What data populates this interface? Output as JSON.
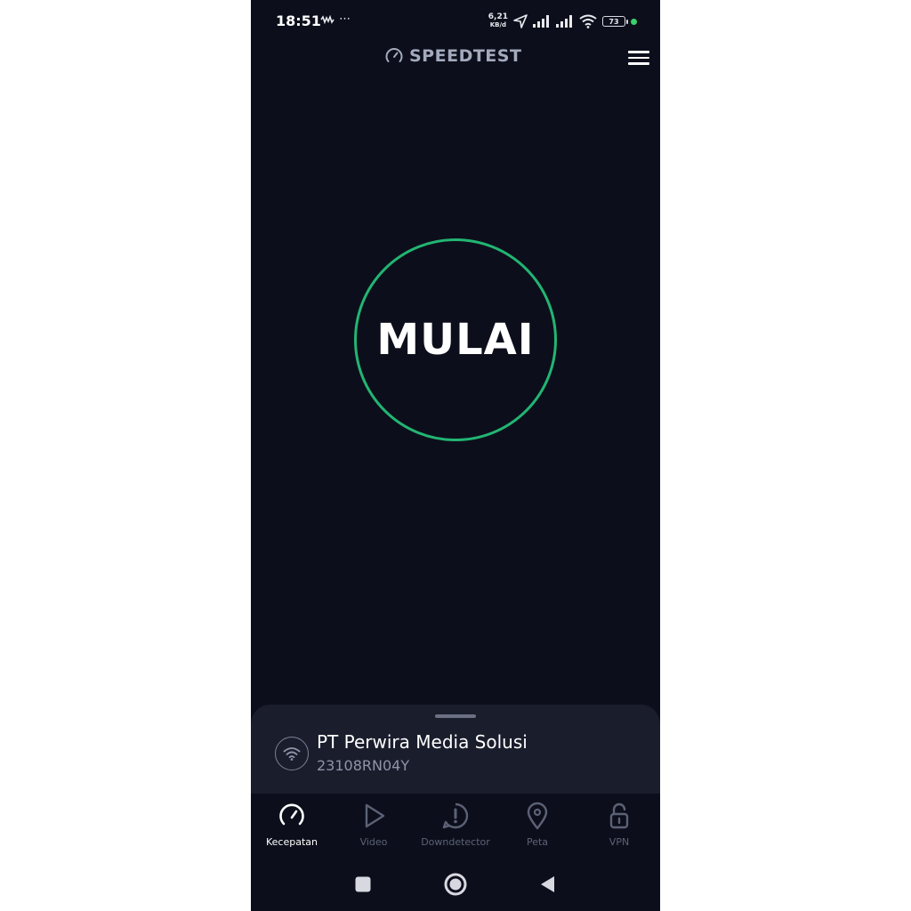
{
  "status_bar": {
    "time": "18:51",
    "left_icons": "⋯",
    "net_speed_value": "6,21",
    "net_speed_unit": "KB/d",
    "battery": "73",
    "icons": [
      "signal-strength-icon",
      "location-arrow-icon",
      "wifi-icon",
      "battery-icon"
    ]
  },
  "header": {
    "brand": "SPEEDTEST",
    "menu_icon": "hamburger-menu-icon"
  },
  "main": {
    "start_label": "MULAI",
    "ring_color": "#22b573"
  },
  "connection": {
    "provider": "PT Perwira Media Solusi",
    "device": "23108RN04Y",
    "icon": "wifi-icon"
  },
  "bottom_nav": {
    "items": [
      {
        "label": "Kecepatan",
        "icon": "speedometer-icon",
        "active": true
      },
      {
        "label": "Video",
        "icon": "play-icon",
        "active": false
      },
      {
        "label": "Downdetector",
        "icon": "alert-bubble-icon",
        "active": false
      },
      {
        "label": "Peta",
        "icon": "map-pin-icon",
        "active": false
      },
      {
        "label": "VPN",
        "icon": "unlocked-padlock-icon",
        "active": false
      }
    ]
  },
  "system_nav": {
    "icons": [
      "recents-square-icon",
      "home-circle-icon",
      "back-triangle-icon"
    ]
  },
  "colors": {
    "background": "#0c0f1b",
    "sheet": "#1a1d2c",
    "accent_green": "#22b573",
    "inactive": "#5c6176"
  }
}
